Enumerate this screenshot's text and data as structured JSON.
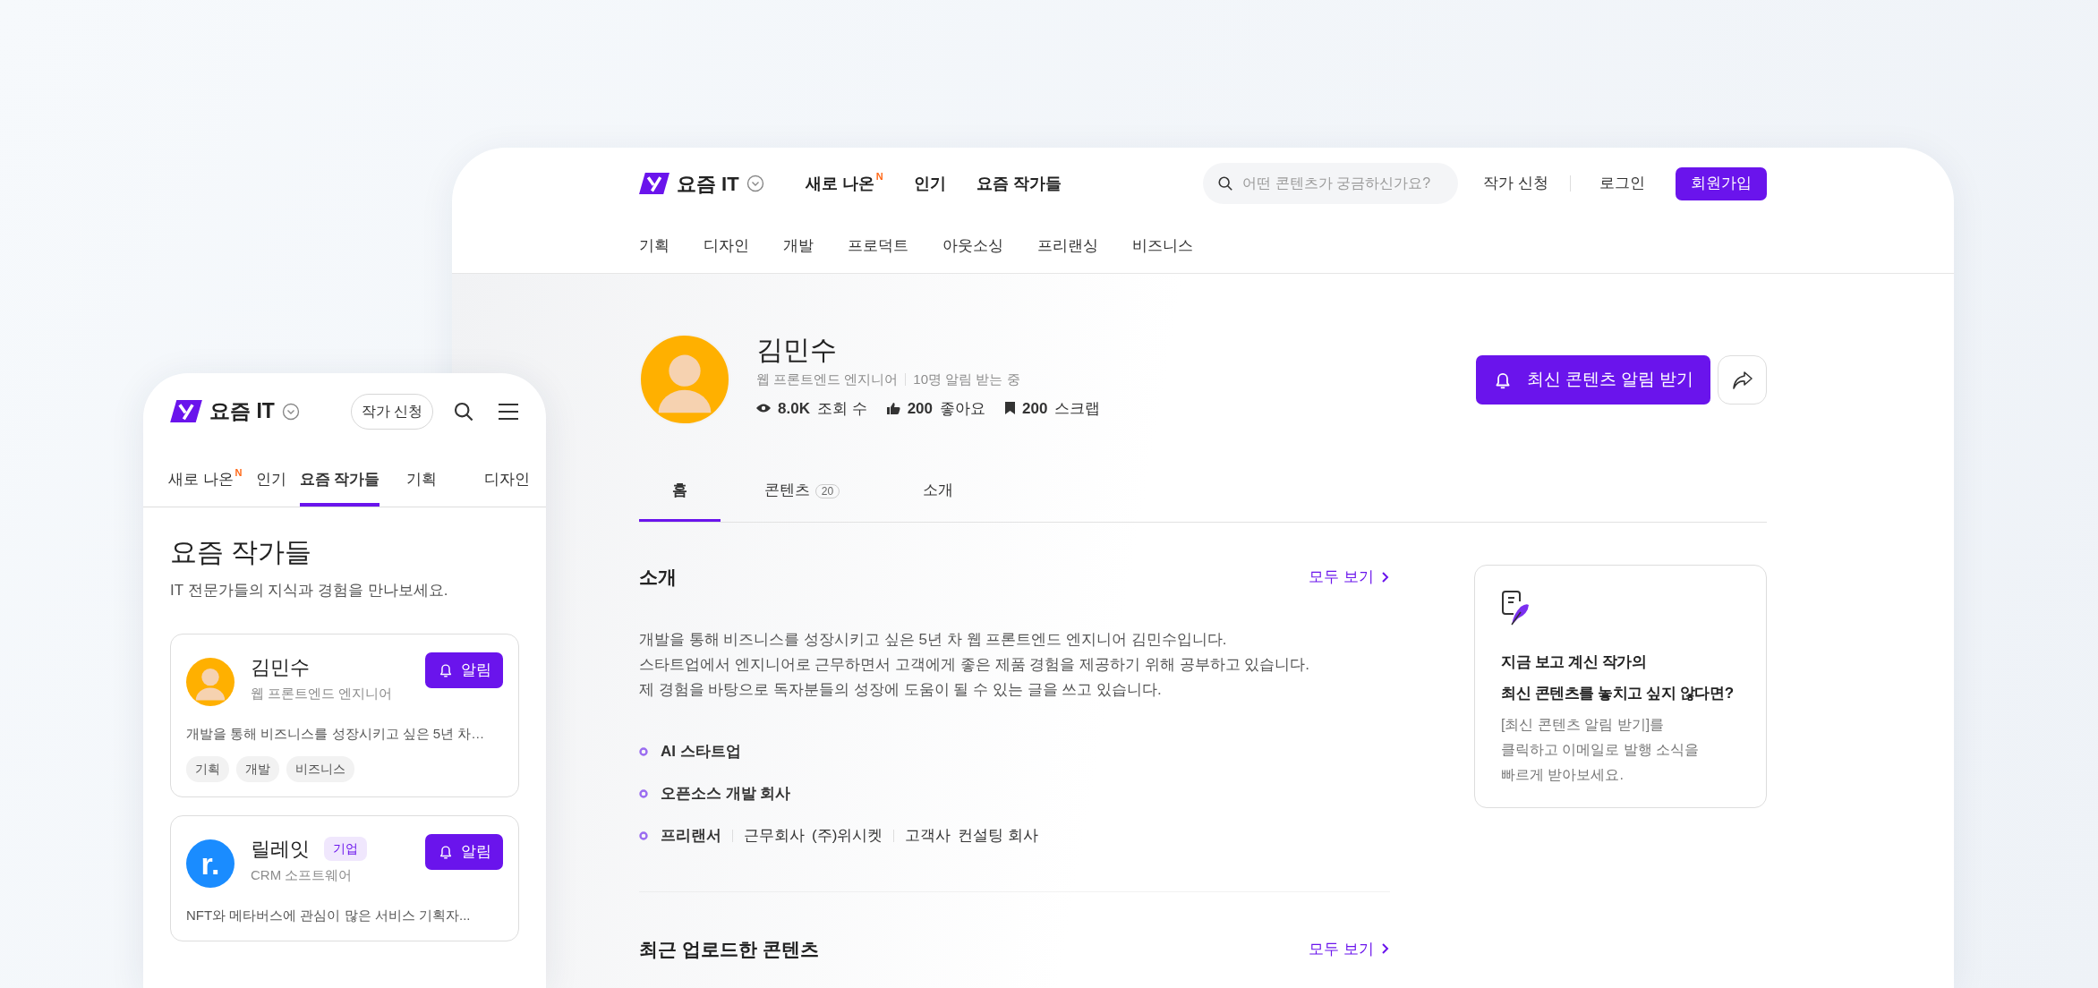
{
  "desktop": {
    "header": {
      "logo": "요즘 IT",
      "nav": [
        {
          "label": "새로 나온",
          "badge": "N"
        },
        {
          "label": "인기"
        },
        {
          "label": "요즘 작가들"
        }
      ],
      "search": {
        "placeholder": "어떤 콘텐츠가 궁금하신가요?"
      },
      "links": [
        "작가 신청",
        "로그인"
      ],
      "signup": "회원가입"
    },
    "categories": [
      "기획",
      "디자인",
      "개발",
      "프로덕트",
      "아웃소싱",
      "프리랜싱",
      "비즈니스"
    ],
    "profile": {
      "name": "김민수",
      "role": "웹 프론트엔드 엔지니어",
      "subscribers": "10명 알림 받는 중",
      "notify_button": "최신 콘텐츠 알림 받기",
      "stats": [
        {
          "kind": "views",
          "value": "8.0K",
          "label": "조회 수"
        },
        {
          "kind": "likes",
          "value": "200",
          "label": "좋아요"
        },
        {
          "kind": "scraps",
          "value": "200",
          "label": "스크랩"
        }
      ]
    },
    "tabs": [
      {
        "label": "홈",
        "selected": true
      },
      {
        "label": "콘텐츠",
        "count": "20",
        "selected": false
      },
      {
        "label": "소개",
        "selected": false
      }
    ],
    "intro": {
      "title": "소개",
      "more": "모두 보기",
      "lines": [
        "개발을 통해 비즈니스를 성장시키고 싶은 5년 차 웹 프론트엔드 엔지니어 김민수입니다.",
        "스타트업에서 엔지니어로 근무하면서 고객에게 좋은 제품 경험을 제공하기 위해 공부하고 있습니다.",
        "제 경험을 바탕으로 독자분들의 성장에 도움이 될 수 있는 글을 쓰고 있습니다."
      ],
      "careers": [
        {
          "title": "AI 스타트업"
        },
        {
          "title": "오픈소스 개발 회사"
        },
        {
          "title": "프리랜서",
          "details": [
            {
              "label": "근무회사",
              "value": "(주)위시켓"
            },
            {
              "label": "고객사",
              "value": "컨설팅 회사"
            }
          ]
        }
      ]
    },
    "recent": {
      "title": "최근 업로드한 콘텐츠",
      "more": "모두 보기"
    },
    "promo": {
      "title_lines": [
        "지금 보고 계신 작가의",
        "최신 콘텐츠를 놓치고 싶지 않다면?"
      ],
      "body_lines": [
        "[최신 콘텐츠 알림 받기]를",
        "클릭하고 이메일로 발행 소식을",
        "빠르게 받아보세요."
      ]
    }
  },
  "mobile": {
    "logo": "요즘 IT",
    "apply": "작가 신청",
    "tabs": [
      {
        "label": "새로 나온",
        "badge": "N",
        "kind": "section",
        "selected": false
      },
      {
        "label": "인기",
        "kind": "section",
        "selected": false
      },
      {
        "label": "요즘 작가들",
        "kind": "section",
        "selected": true
      },
      {
        "label": "기획",
        "kind": "category",
        "selected": false
      },
      {
        "label": "디자인",
        "kind": "category",
        "selected": false
      }
    ],
    "title": "요즘 작가들",
    "subtitle": "IT 전문가들의 지식과 경험을 만나보세요.",
    "cards": [
      {
        "kind": "person",
        "name": "김민수",
        "role": "웹 프론트엔드 엔지니어",
        "button": "알림",
        "summary": "개발을 통해 비즈니스를 성장시키고 싶은 5년 차…",
        "tags": [
          "기획",
          "개발",
          "비즈니스"
        ]
      },
      {
        "kind": "company",
        "logo_text": "r.",
        "name": "릴레잇",
        "badge": "기업",
        "role": "CRM 소프트웨어",
        "button": "알림",
        "summary": "NFT와 메타버스에 관심이 많은 서비스 기획자..."
      }
    ]
  }
}
